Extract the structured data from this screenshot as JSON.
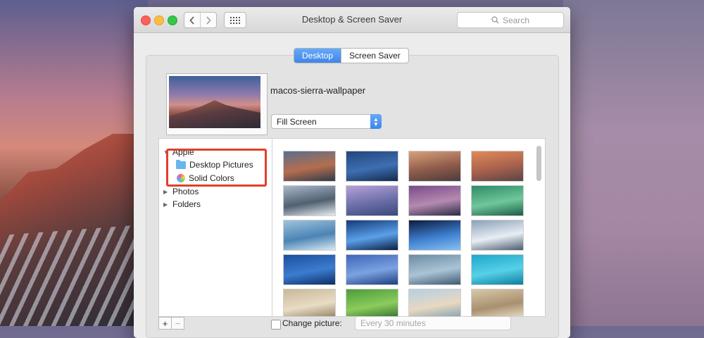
{
  "window": {
    "title": "Desktop & Screen Saver",
    "search_placeholder": "Search",
    "nav_back_icon": "chevron-left-icon",
    "nav_forward_icon": "chevron-right-icon",
    "show_all_icon": "grid-icon"
  },
  "tabs": [
    {
      "label": "Desktop",
      "active": true
    },
    {
      "label": "Screen Saver",
      "active": false
    }
  ],
  "current_wallpaper": {
    "name": "macos-sierra-wallpaper",
    "fit_option": "Fill Screen"
  },
  "sidebar": {
    "groups": [
      {
        "label": "Apple",
        "expanded": true,
        "children": [
          {
            "label": "Desktop Pictures",
            "icon": "folder-icon"
          },
          {
            "label": "Solid Colors",
            "icon": "color-wheel-icon"
          }
        ]
      },
      {
        "label": "Photos",
        "expanded": false
      },
      {
        "label": "Folders",
        "expanded": false
      }
    ]
  },
  "thumbnails": [
    {
      "name": "el-capitan-1",
      "colors": [
        "#5b6f8c",
        "#b56d4e",
        "#2f3a4a"
      ]
    },
    {
      "name": "yosemite-night",
      "colors": [
        "#23457c",
        "#3d6fb1",
        "#142a4c"
      ]
    },
    {
      "name": "half-dome-sunset",
      "colors": [
        "#d9a07a",
        "#8e5b4a",
        "#4b3c3d"
      ]
    },
    {
      "name": "el-capitan-sunset",
      "colors": [
        "#e38a57",
        "#a8614d",
        "#5a4444"
      ]
    },
    {
      "name": "yosemite-winter",
      "colors": [
        "#a8b8c8",
        "#506070",
        "#e6ecf0"
      ]
    },
    {
      "name": "lavender-mountains",
      "colors": [
        "#b8a0d8",
        "#6a6ea8",
        "#3c4878"
      ]
    },
    {
      "name": "purple-valley",
      "colors": [
        "#7a4a8a",
        "#b58ab0",
        "#2d2a48"
      ]
    },
    {
      "name": "green-wave",
      "colors": [
        "#2f8c66",
        "#6fc79b",
        "#1d5c48"
      ]
    },
    {
      "name": "blue-wave",
      "colors": [
        "#9ec3dc",
        "#4b84b5",
        "#d8e8f2"
      ]
    },
    {
      "name": "galaxy-blue",
      "colors": [
        "#143b78",
        "#5aa0e8",
        "#0b1e44"
      ]
    },
    {
      "name": "earth-orbit",
      "colors": [
        "#0c1c3c",
        "#3f7fd0",
        "#86c0f0"
      ]
    },
    {
      "name": "planet-surface",
      "colors": [
        "#8aa0b8",
        "#e8eef4",
        "#4c5c70"
      ]
    },
    {
      "name": "deep-blue",
      "colors": [
        "#1c4f9c",
        "#3c7cd0",
        "#0d2e66"
      ]
    },
    {
      "name": "starry-blue",
      "colors": [
        "#3e66b8",
        "#7ba2e0",
        "#1e3e80"
      ]
    },
    {
      "name": "cloud-texture",
      "colors": [
        "#6c8ca2",
        "#aac4d6",
        "#3e5a70"
      ]
    },
    {
      "name": "teal-water",
      "colors": [
        "#1fa7c9",
        "#56d0e8",
        "#0e7e9e"
      ]
    },
    {
      "name": "sand-horizon",
      "colors": [
        "#c8b89a",
        "#e8dcc4",
        "#8e7a5c"
      ]
    },
    {
      "name": "green-fields",
      "colors": [
        "#4c9c3c",
        "#8ccc5c",
        "#2c6c2c"
      ]
    },
    {
      "name": "beach-sky",
      "colors": [
        "#b4d0e4",
        "#e8d8c0",
        "#7c9cb4"
      ]
    },
    {
      "name": "desert-dunes",
      "colors": [
        "#d8c8a8",
        "#a89070",
        "#f0e4cc"
      ]
    }
  ],
  "bottom": {
    "add_label": "+",
    "remove_label": "−",
    "change_picture_label": "Change picture:",
    "interval_value": "Every 30 minutes"
  }
}
